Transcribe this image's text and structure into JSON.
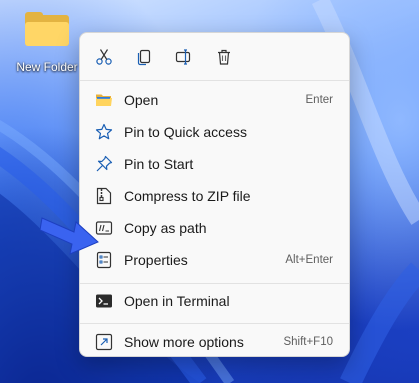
{
  "desktop": {
    "icon_label": "New Folder"
  },
  "context_menu": {
    "toolbar": [
      {
        "icon": "cut-icon"
      },
      {
        "icon": "copy-icon"
      },
      {
        "icon": "rename-icon"
      },
      {
        "icon": "delete-icon"
      }
    ],
    "items": [
      {
        "icon": "folder-open-icon",
        "label": "Open",
        "shortcut": "Enter"
      },
      {
        "icon": "star-icon",
        "label": "Pin to Quick access",
        "shortcut": ""
      },
      {
        "icon": "pin-icon",
        "label": "Pin to Start",
        "shortcut": ""
      },
      {
        "icon": "zip-icon",
        "label": "Compress to ZIP file",
        "shortcut": ""
      },
      {
        "icon": "copy-path-icon",
        "label": "Copy as path",
        "shortcut": ""
      },
      {
        "icon": "properties-icon",
        "label": "Properties",
        "shortcut": "Alt+Enter"
      },
      {
        "icon": "terminal-icon",
        "label": "Open in Terminal",
        "shortcut": ""
      },
      {
        "icon": "more-options-icon",
        "label": "Show more options",
        "shortcut": "Shift+F10"
      }
    ]
  },
  "colors": {
    "menu_background": "#f9f9f9",
    "icon_accent": "#1a5fb4",
    "folder_yellow": "#ffd666",
    "arrow_blue": "#3a63f0"
  }
}
